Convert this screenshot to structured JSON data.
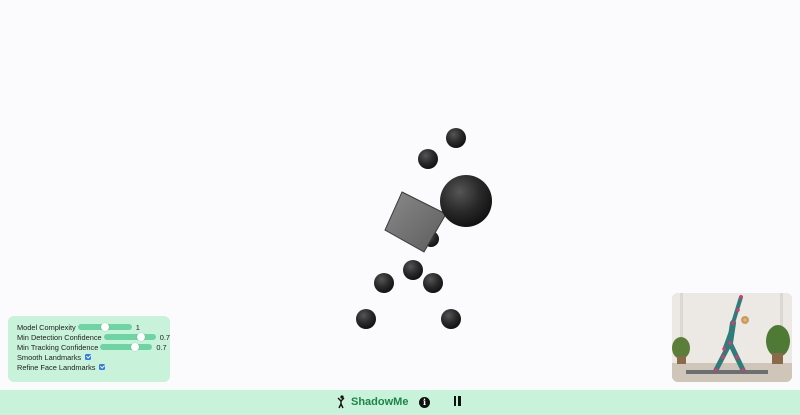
{
  "app": {
    "name": "ShadowMe"
  },
  "controls": {
    "model_complexity": {
      "label": "Model Complexity",
      "value": "1",
      "level": 0.5
    },
    "min_detection_confidence": {
      "label": "Min Detection Confidence",
      "value": "0.7",
      "level": 0.7
    },
    "min_tracking_confidence": {
      "label": "Min Tracking Confidence",
      "value": "0.7",
      "level": 0.7
    },
    "smooth_landmarks": {
      "label": "Smooth Landmarks",
      "checked": true
    },
    "refine_face_landmarks": {
      "label": "Refine Face Landmarks",
      "checked": true
    }
  },
  "bottombar": {
    "brand_label": "ShadowMe",
    "info_glyph": "i"
  },
  "icons": {
    "brand": "stick-figure-icon",
    "info": "info-icon",
    "pause": "pause-icon"
  },
  "colors": {
    "accent": "#c9f2da",
    "slider": "#6fd4a3",
    "brand_text": "#1e8449",
    "checkbox": "#2f7de1",
    "spheres": "#2a2a2a"
  }
}
